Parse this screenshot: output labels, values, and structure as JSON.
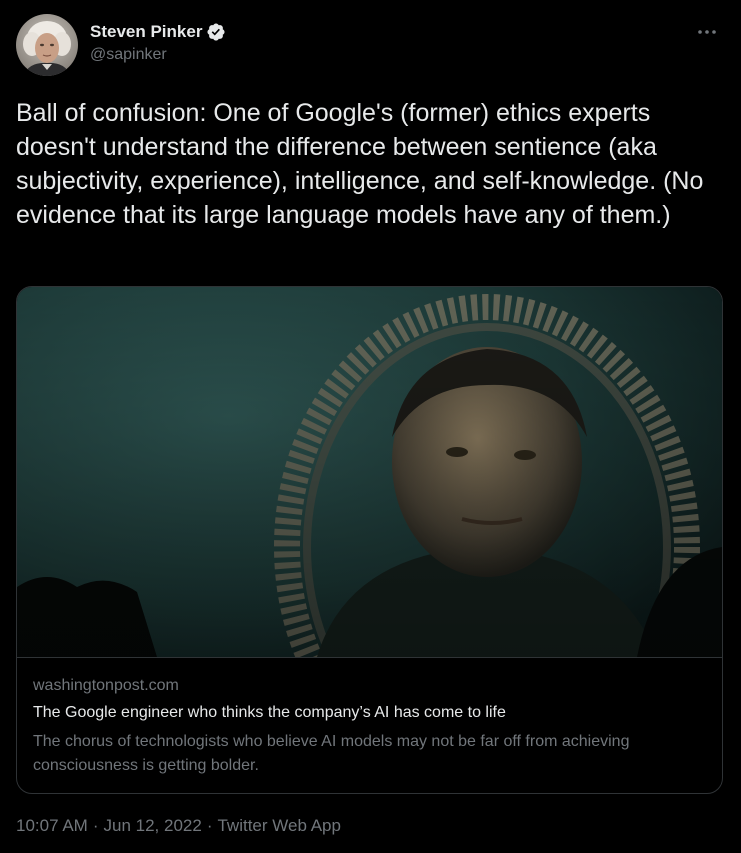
{
  "author": {
    "display_name": "Steven Pinker",
    "handle": "@sapinker",
    "verified": true,
    "avatar_icon": "avatar-photo-icon",
    "verified_icon": "verified-badge-icon",
    "more_icon": "more-options-icon"
  },
  "tweet": {
    "text": "Ball of confusion: One of Google's (former) ethics experts doesn't understand the difference between sentience (aka subjectivity, experience), intelligence, and self-knowledge. (No evidence that its large language models have any of them.)"
  },
  "card": {
    "domain": "washingtonpost.com",
    "title": "The Google engineer who thinks the company’s AI has come to life",
    "description": "The chorus of technologists who believe AI models may not be far off from achieving consciousness is getting bolder."
  },
  "meta": {
    "time": "10:07 AM",
    "separator": "·",
    "date": "Jun 12, 2022",
    "source": "Twitter Web App"
  },
  "colors": {
    "background": "#000000",
    "text_primary": "#e7e9ea",
    "text_secondary": "#71767b",
    "border": "#2f3336",
    "verified": "#e7e9ea"
  }
}
